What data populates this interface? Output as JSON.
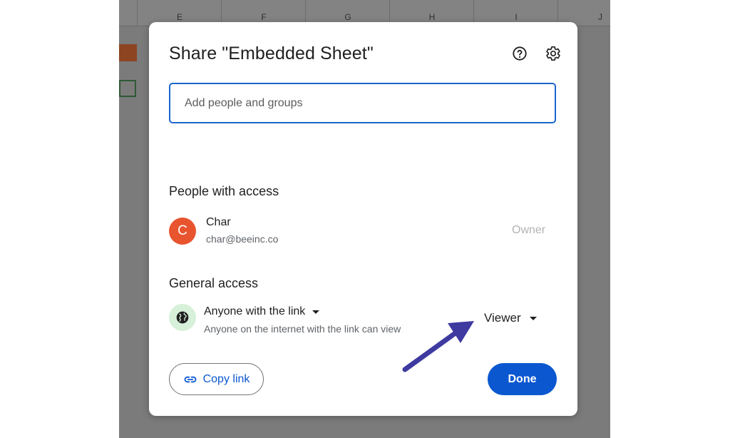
{
  "sheet": {
    "columns": [
      "E",
      "F",
      "G",
      "H",
      "I",
      "J"
    ]
  },
  "dialog": {
    "title": "Share \"Embedded Sheet\"",
    "help_icon": "help-circle-icon",
    "settings_icon": "gear-icon",
    "people_input": {
      "placeholder": "Add people and groups",
      "value": ""
    },
    "people_with_access": {
      "title": "People with access",
      "owner": {
        "avatar_letter": "C",
        "avatar_color": "#e8542e",
        "name": "Char",
        "email": "char@beeinc.co",
        "role": "Owner"
      }
    },
    "general_access": {
      "title": "General access",
      "icon": "globe-icon",
      "scope": "Anyone with the link",
      "description": "Anyone on the internet with the link can view",
      "role": "Viewer"
    },
    "copy_link_label": "Copy link",
    "copy_link_icon": "link-icon",
    "done_label": "Done"
  },
  "colors": {
    "accent": "#0b57d0",
    "input_border": "#1a66cc",
    "annotation_arrow": "#3e3aa0"
  }
}
